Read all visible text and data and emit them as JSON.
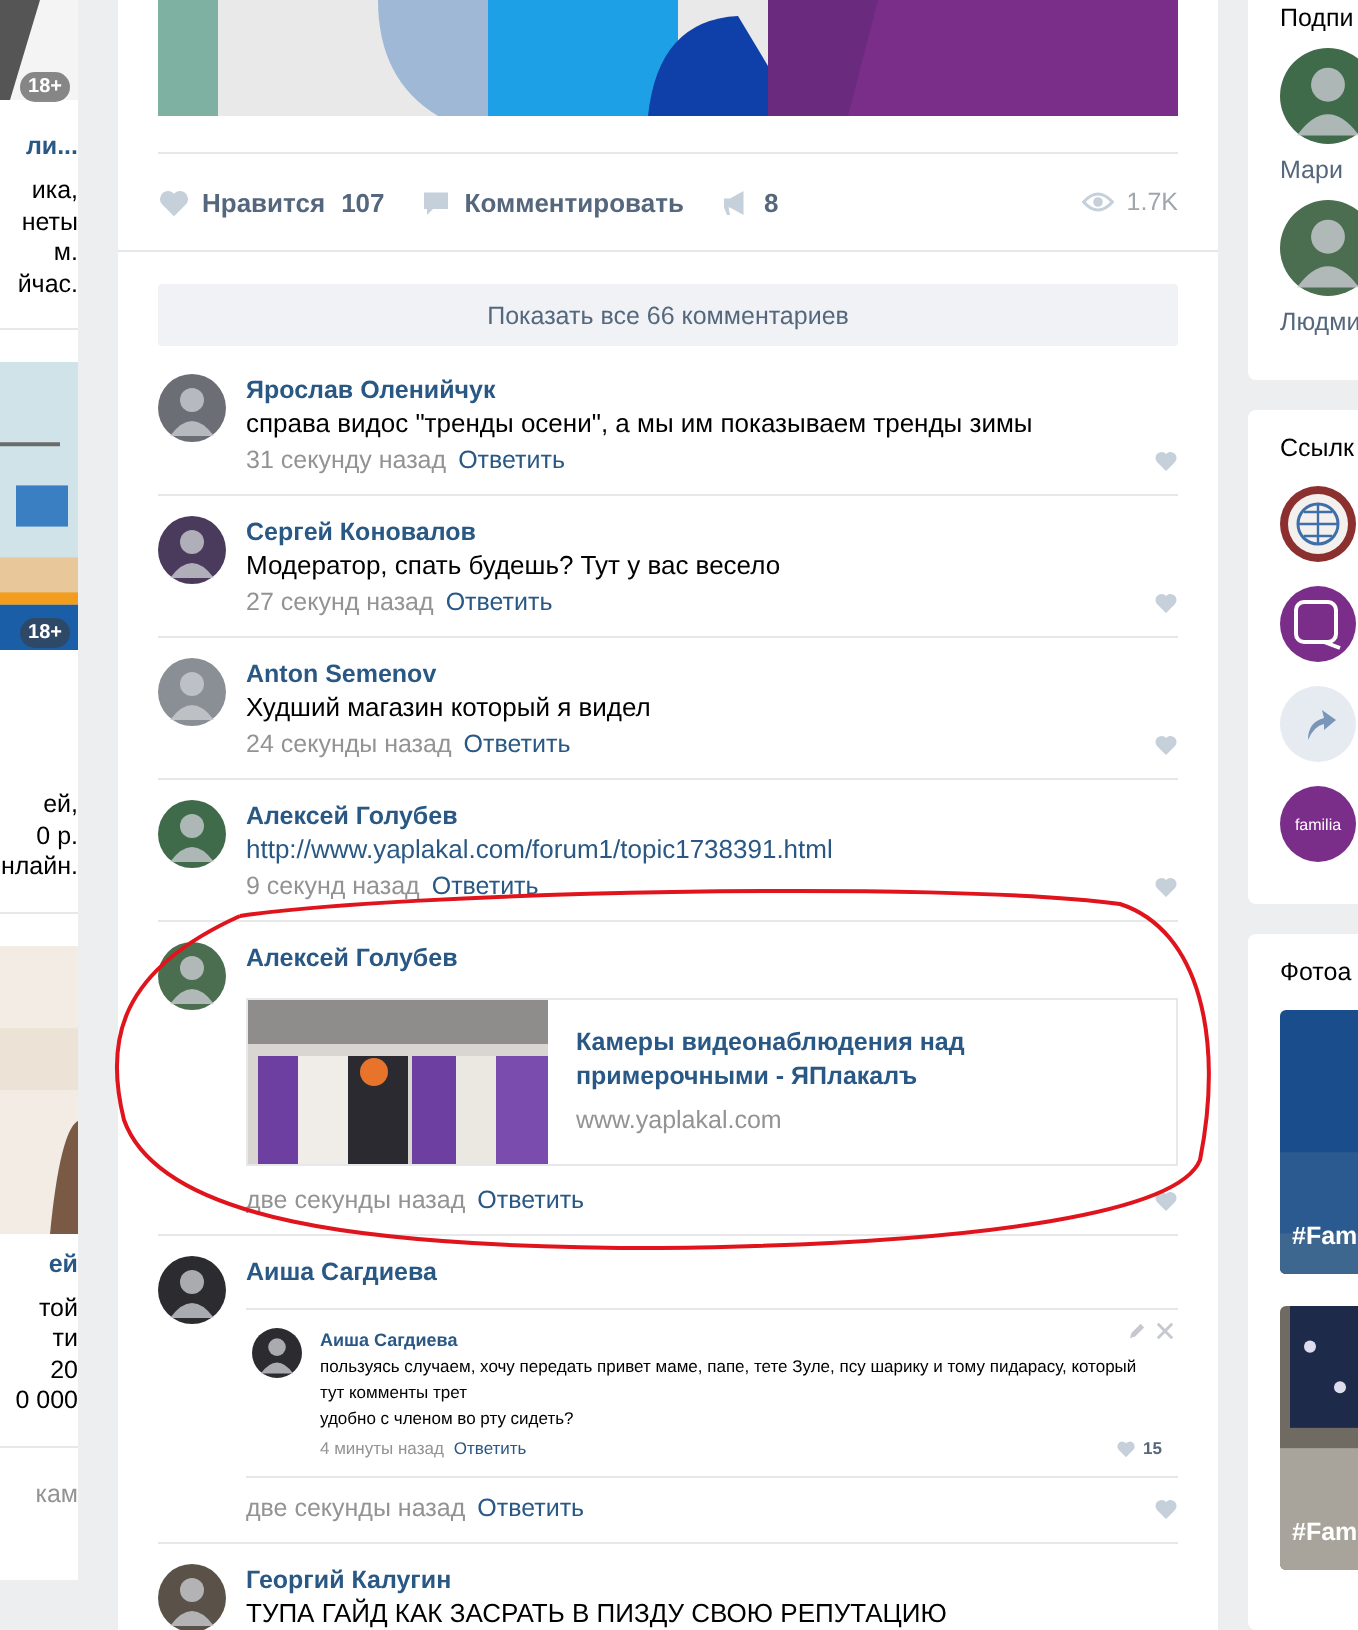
{
  "left_ads": [
    {
      "badge": "18+",
      "title": "ли...",
      "lines": [
        "ика,",
        "неты",
        "м.",
        "йчас."
      ]
    },
    {
      "badge": "18+",
      "lines": [
        "ей,",
        "0 р.",
        "нлайн."
      ]
    },
    {
      "title": "ей",
      "lines": [
        "той",
        "ти",
        "20",
        "0 000"
      ]
    }
  ],
  "left_footer": "кам",
  "post": {
    "actions": {
      "like_label": "Нравится",
      "like_count": "107",
      "comment_label": "Комментировать",
      "share_count": "8",
      "views": "1.7K"
    },
    "show_all": "Показать все 66 комментариев",
    "comments": [
      {
        "kind": "text",
        "author": "Ярослав Оленийчук",
        "text": "справа видос \"тренды осени\", а мы им показываем тренды зимы",
        "time": "31 секунду назад",
        "reply": "Ответить"
      },
      {
        "kind": "text",
        "author": "Сергей Коновалов",
        "text": "Модератор, спать будешь? Тут у вас весело",
        "time": "27 секунд назад",
        "reply": "Ответить"
      },
      {
        "kind": "text",
        "author": "Anton Semenov",
        "text": "Худший магазин который я видел",
        "time": "24 секунды назад",
        "reply": "Ответить"
      },
      {
        "kind": "url",
        "author": "Алексей Голубев",
        "text": "http://www.yaplakal.com/forum1/topic1738391.html",
        "time": "9 секунд назад",
        "reply": "Ответить"
      },
      {
        "kind": "link",
        "author": "Алексей Голубев",
        "link": {
          "title": "Камеры видеонаблюдения над примерочными - ЯПлакалъ",
          "domain": "www.yaplakal.com"
        },
        "time": "две секунды назад",
        "reply": "Ответить"
      },
      {
        "kind": "quote",
        "author": "Аиша Сагдиева",
        "quote": {
          "author": "Аиша Сагдиева",
          "lines": [
            "пользуясь случаем, хочу передать привет маме, папе, тете Зуле, псу шарику и тому пидарасу, который тут комменты трет",
            "удобно с членом во рту сидеть?"
          ],
          "time": "4 минуты назад",
          "reply": "Ответить",
          "likes": "15"
        },
        "time": "две секунды назад",
        "reply": "Ответить"
      },
      {
        "kind": "text",
        "author": "Георгий Калугин",
        "text": "ТУПА ГАЙД КАК ЗАСРАТЬ В ПИЗДУ СВОЮ РЕПУТАЦИЮ"
      }
    ]
  },
  "right": {
    "subscribers": {
      "title": "Подпи",
      "people": [
        "Мари",
        "Людми"
      ]
    },
    "links": {
      "title": "Ссылк",
      "items": [
        {
          "kind": "globe"
        },
        {
          "kind": "square"
        },
        {
          "kind": "arrow"
        },
        {
          "kind": "logo",
          "text": "familia"
        }
      ]
    },
    "photos": {
      "title": "Фотоа",
      "albums": [
        "#Fam",
        "#Fam"
      ]
    }
  }
}
